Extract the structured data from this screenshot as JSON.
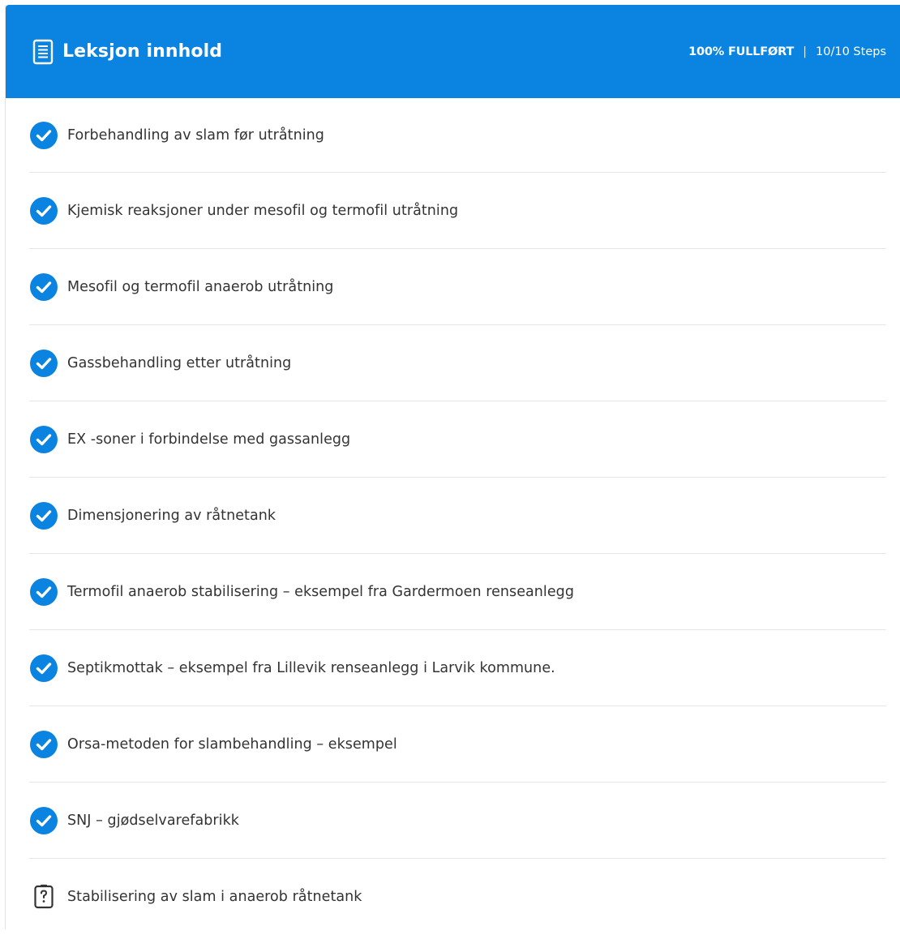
{
  "header": {
    "title": "Leksjon innhold",
    "icon": "document-icon",
    "progress_label": "100% FULLFØRT",
    "separator": "|",
    "steps_label": "10/10 Steps"
  },
  "colors": {
    "accent": "#0a84e0",
    "check": "#0a84e0",
    "divider": "#e6e6e6"
  },
  "lessons": [
    {
      "label": "Forbehandling av slam før utråtning",
      "status": "completed",
      "icon": "check-circle-icon"
    },
    {
      "label": "Kjemisk reaksjoner under mesofil og termofil utråtning",
      "status": "completed",
      "icon": "check-circle-icon"
    },
    {
      "label": "Mesofil og termofil anaerob utråtning",
      "status": "completed",
      "icon": "check-circle-icon"
    },
    {
      "label": "Gassbehandling etter utråtning",
      "status": "completed",
      "icon": "check-circle-icon"
    },
    {
      "label": "EX -soner i forbindelse med gassanlegg",
      "status": "completed",
      "icon": "check-circle-icon"
    },
    {
      "label": "Dimensjonering av råtnetank",
      "status": "completed",
      "icon": "check-circle-icon"
    },
    {
      "label": "Termofil anaerob stabilisering – eksempel fra Gardermoen renseanlegg",
      "status": "completed",
      "icon": "check-circle-icon"
    },
    {
      "label": "Septikmottak – eksempel fra Lillevik renseanlegg i Larvik kommune.",
      "status": "completed",
      "icon": "check-circle-icon"
    },
    {
      "label": "Orsa-metoden for slambehandling – eksempel",
      "status": "completed",
      "icon": "check-circle-icon"
    },
    {
      "label": "SNJ – gjødselvarefabrikk",
      "status": "completed",
      "icon": "check-circle-icon"
    },
    {
      "label": "Stabilisering av slam i anaerob råtnetank",
      "status": "quiz",
      "icon": "quiz-icon"
    }
  ]
}
